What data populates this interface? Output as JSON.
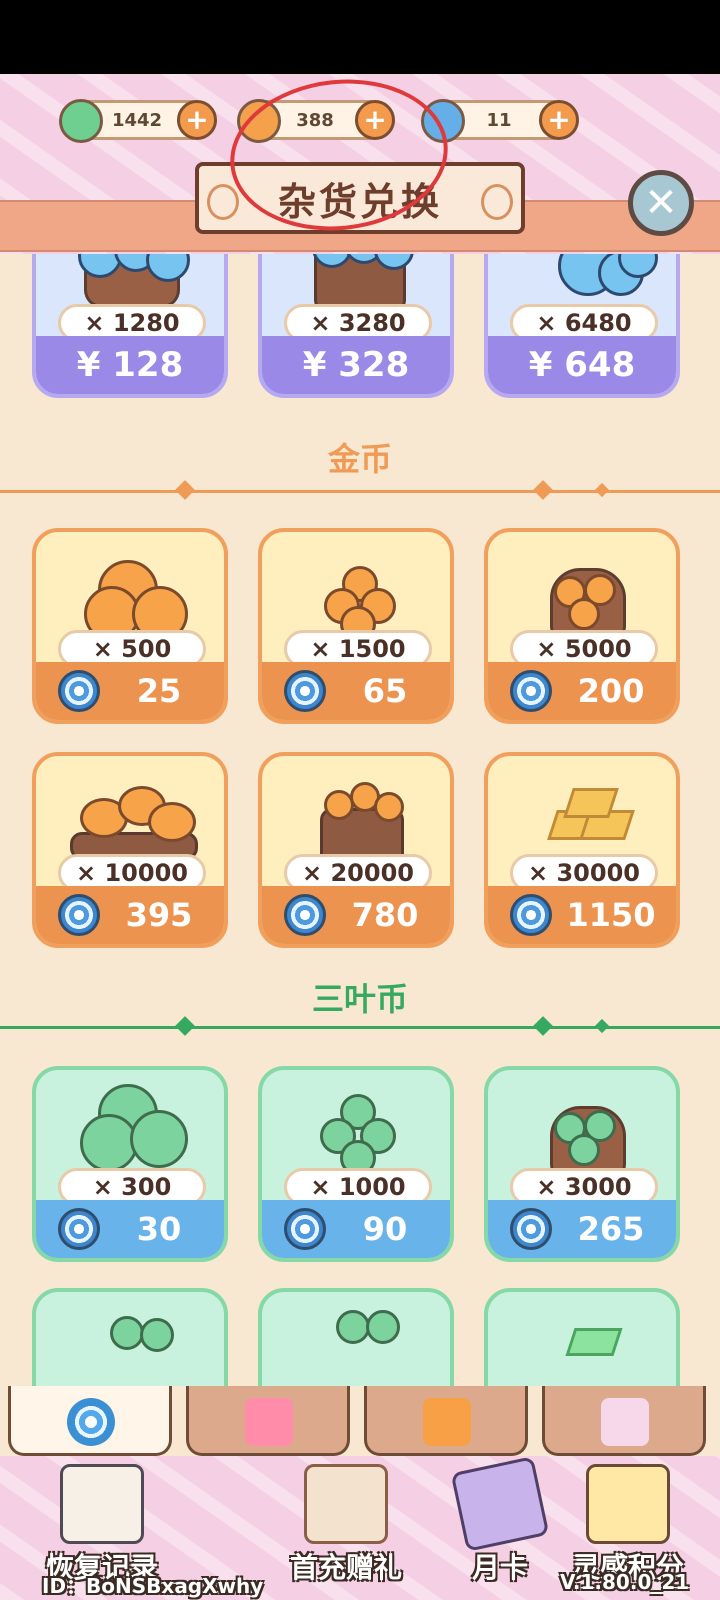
{
  "currencies": [
    {
      "name": "clover",
      "value": "1442",
      "icon": "clover-coin-icon",
      "color": "#6fcf91"
    },
    {
      "name": "gold",
      "value": "388",
      "icon": "gold-coin-icon",
      "color": "#f5a04a"
    },
    {
      "name": "spiral",
      "value": "11",
      "icon": "blue-spiral-icon",
      "color": "#66aee8"
    }
  ],
  "header": {
    "title": "杂货兑换",
    "close_icon": "close-icon"
  },
  "top_cards": [
    {
      "qty": "× 1280",
      "price": "¥ 128"
    },
    {
      "qty": "× 3280",
      "price": "¥ 328"
    },
    {
      "qty": "× 6480",
      "price": "¥ 648"
    }
  ],
  "sections": {
    "gold": {
      "title": "金币",
      "items": [
        {
          "qty": "× 500",
          "price": "25"
        },
        {
          "qty": "× 1500",
          "price": "65"
        },
        {
          "qty": "× 5000",
          "price": "200"
        },
        {
          "qty": "× 10000",
          "price": "395"
        },
        {
          "qty": "× 20000",
          "price": "780"
        },
        {
          "qty": "× 30000",
          "price": "1150"
        }
      ]
    },
    "clover": {
      "title": "三叶币",
      "items": [
        {
          "qty": "× 300",
          "price": "30"
        },
        {
          "qty": "× 1000",
          "price": "90"
        },
        {
          "qty": "× 3000",
          "price": "265"
        }
      ]
    }
  },
  "tabs": [
    {
      "name": "spiral-tab",
      "icon": "spiral-icon",
      "active": true
    },
    {
      "name": "clothes-tab",
      "icon": "shirt-icon",
      "active": false
    },
    {
      "name": "gift-tab",
      "icon": "gift-icon",
      "active": false
    },
    {
      "name": "scroll-tab",
      "icon": "scroll-icon",
      "active": false
    }
  ],
  "bottom_nav": [
    {
      "label": "恢复记录",
      "icon": "clipboard-icon"
    },
    {
      "label": "首充赠礼",
      "icon": "envelope-gift-icon"
    },
    {
      "label": "月卡",
      "icon": "card-icon"
    },
    {
      "label": "灵感积分",
      "icon": "lightbulb-icon"
    }
  ],
  "footer": {
    "id_text": "ID：BoNSBxagXwhy",
    "version": "V.1.80.0_21"
  }
}
